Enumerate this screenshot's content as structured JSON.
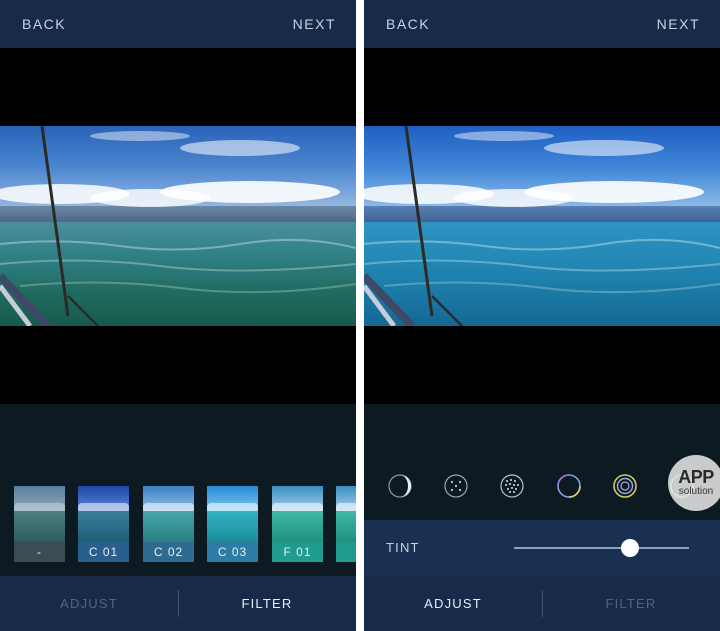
{
  "colors": {
    "top_bar": "#172a4a",
    "panel_background": "#0b1720",
    "tab_active": "#e6edf5",
    "tab_inactive": "#4f6584",
    "tint_row": "#1a3052"
  },
  "left_screen": {
    "header": {
      "back": "BACK",
      "next": "NEXT"
    },
    "filters": [
      {
        "label": "-",
        "style": "original"
      },
      {
        "label": "C 01",
        "style": "cool"
      },
      {
        "label": "C 02",
        "style": "cool-light"
      },
      {
        "label": "C 03",
        "style": "cool-bright"
      },
      {
        "label": "F 01",
        "style": "fade-teal"
      },
      {
        "label": "F",
        "style": "fade-teal"
      }
    ],
    "tabs": {
      "adjust": "ADJUST",
      "filter": "FILTER",
      "active": "filter"
    }
  },
  "right_screen": {
    "header": {
      "back": "BACK",
      "next": "NEXT"
    },
    "tools": [
      "crescent-icon",
      "dotted-circle-icon",
      "grain-icon",
      "color-ring-icon",
      "double-ring-icon",
      "tint-icon"
    ],
    "active_tool": "tint-icon",
    "tint": {
      "label": "TINT",
      "value": 0.66
    },
    "tabs": {
      "adjust": "ADJUST",
      "filter": "FILTER",
      "active": "adjust"
    }
  },
  "watermark": {
    "line1": "APP",
    "line2": "solution"
  }
}
